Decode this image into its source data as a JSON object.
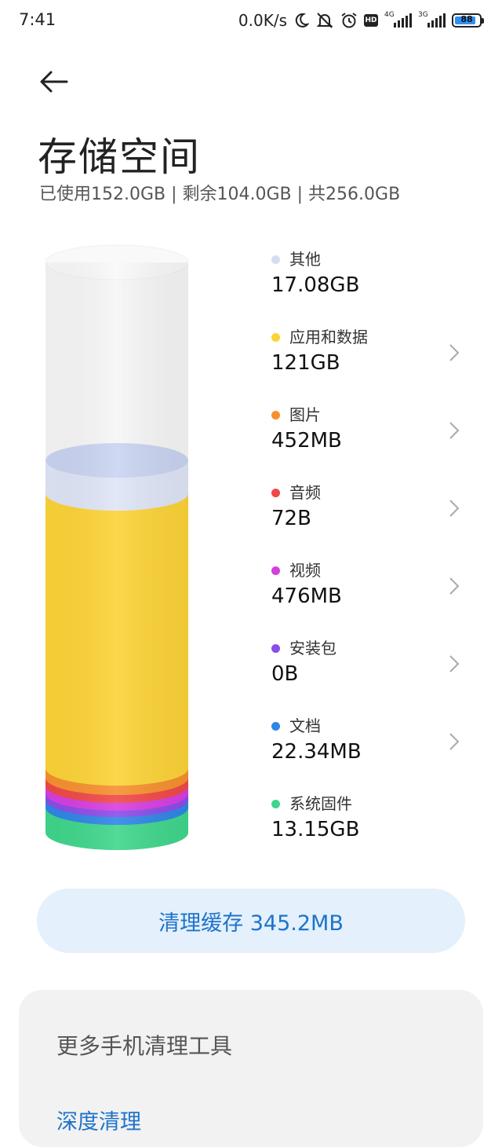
{
  "status_bar": {
    "time": "7:41",
    "net_speed": "0.0K/s",
    "icons": [
      "moon-icon",
      "mute-icon",
      "alarm-icon",
      "hd-icon",
      "signal-4g-icon",
      "signal-3g-icon",
      "battery-icon"
    ],
    "hd_label": "HD",
    "sim1_label": "4G",
    "sim2_label": "3G",
    "battery_level": "88"
  },
  "header": {
    "back_icon": "arrow-left-icon",
    "title": "存储空间",
    "summary": "已使用152.0GB | 剩余104.0GB | 共256.0GB"
  },
  "storage": {
    "used_gb": 152.0,
    "free_gb": 104.0,
    "total_gb": 256.0,
    "categories": [
      {
        "label": "其他",
        "value": "17.08GB",
        "color": "#d5dcf3",
        "has_chevron": false
      },
      {
        "label": "应用和数据",
        "value": "121GB",
        "color": "#fcd337",
        "has_chevron": true
      },
      {
        "label": "图片",
        "value": "452MB",
        "color": "#f6902e",
        "has_chevron": true
      },
      {
        "label": "音频",
        "value": "72B",
        "color": "#f04848",
        "has_chevron": true
      },
      {
        "label": "视频",
        "value": "476MB",
        "color": "#d63ee0",
        "has_chevron": true
      },
      {
        "label": "安装包",
        "value": "0B",
        "color": "#8a4de8",
        "has_chevron": true
      },
      {
        "label": "文档",
        "value": "22.34MB",
        "color": "#2f86e6",
        "has_chevron": true
      },
      {
        "label": "系统固件",
        "value": "13.15GB",
        "color": "#3fd68b",
        "has_chevron": false
      }
    ]
  },
  "clean_button": {
    "label": "清理缓存 345.2MB"
  },
  "tools": {
    "title": "更多手机清理工具",
    "deep_clean": "深度清理"
  }
}
